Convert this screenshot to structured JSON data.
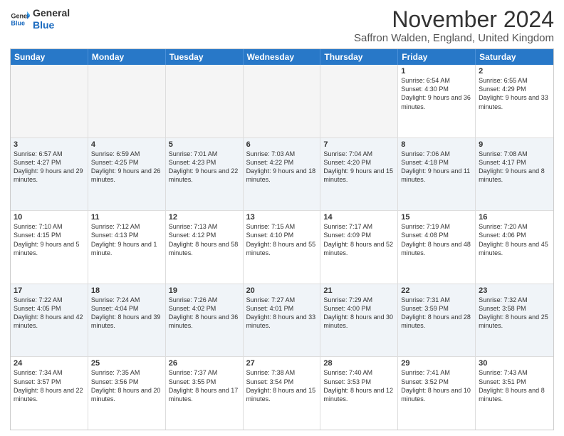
{
  "logo": {
    "general": "General",
    "blue": "Blue"
  },
  "title": "November 2024",
  "location": "Saffron Walden, England, United Kingdom",
  "header": {
    "days": [
      "Sunday",
      "Monday",
      "Tuesday",
      "Wednesday",
      "Thursday",
      "Friday",
      "Saturday"
    ]
  },
  "rows": [
    {
      "alt": false,
      "cells": [
        {
          "day": "",
          "text": "",
          "empty": true
        },
        {
          "day": "",
          "text": "",
          "empty": true
        },
        {
          "day": "",
          "text": "",
          "empty": true
        },
        {
          "day": "",
          "text": "",
          "empty": true
        },
        {
          "day": "",
          "text": "",
          "empty": true
        },
        {
          "day": "1",
          "text": "Sunrise: 6:54 AM\nSunset: 4:30 PM\nDaylight: 9 hours and 36 minutes.",
          "empty": false
        },
        {
          "day": "2",
          "text": "Sunrise: 6:55 AM\nSunset: 4:29 PM\nDaylight: 9 hours and 33 minutes.",
          "empty": false
        }
      ]
    },
    {
      "alt": true,
      "cells": [
        {
          "day": "3",
          "text": "Sunrise: 6:57 AM\nSunset: 4:27 PM\nDaylight: 9 hours and 29 minutes.",
          "empty": false
        },
        {
          "day": "4",
          "text": "Sunrise: 6:59 AM\nSunset: 4:25 PM\nDaylight: 9 hours and 26 minutes.",
          "empty": false
        },
        {
          "day": "5",
          "text": "Sunrise: 7:01 AM\nSunset: 4:23 PM\nDaylight: 9 hours and 22 minutes.",
          "empty": false
        },
        {
          "day": "6",
          "text": "Sunrise: 7:03 AM\nSunset: 4:22 PM\nDaylight: 9 hours and 18 minutes.",
          "empty": false
        },
        {
          "day": "7",
          "text": "Sunrise: 7:04 AM\nSunset: 4:20 PM\nDaylight: 9 hours and 15 minutes.",
          "empty": false
        },
        {
          "day": "8",
          "text": "Sunrise: 7:06 AM\nSunset: 4:18 PM\nDaylight: 9 hours and 11 minutes.",
          "empty": false
        },
        {
          "day": "9",
          "text": "Sunrise: 7:08 AM\nSunset: 4:17 PM\nDaylight: 9 hours and 8 minutes.",
          "empty": false
        }
      ]
    },
    {
      "alt": false,
      "cells": [
        {
          "day": "10",
          "text": "Sunrise: 7:10 AM\nSunset: 4:15 PM\nDaylight: 9 hours and 5 minutes.",
          "empty": false
        },
        {
          "day": "11",
          "text": "Sunrise: 7:12 AM\nSunset: 4:13 PM\nDaylight: 9 hours and 1 minute.",
          "empty": false
        },
        {
          "day": "12",
          "text": "Sunrise: 7:13 AM\nSunset: 4:12 PM\nDaylight: 8 hours and 58 minutes.",
          "empty": false
        },
        {
          "day": "13",
          "text": "Sunrise: 7:15 AM\nSunset: 4:10 PM\nDaylight: 8 hours and 55 minutes.",
          "empty": false
        },
        {
          "day": "14",
          "text": "Sunrise: 7:17 AM\nSunset: 4:09 PM\nDaylight: 8 hours and 52 minutes.",
          "empty": false
        },
        {
          "day": "15",
          "text": "Sunrise: 7:19 AM\nSunset: 4:08 PM\nDaylight: 8 hours and 48 minutes.",
          "empty": false
        },
        {
          "day": "16",
          "text": "Sunrise: 7:20 AM\nSunset: 4:06 PM\nDaylight: 8 hours and 45 minutes.",
          "empty": false
        }
      ]
    },
    {
      "alt": true,
      "cells": [
        {
          "day": "17",
          "text": "Sunrise: 7:22 AM\nSunset: 4:05 PM\nDaylight: 8 hours and 42 minutes.",
          "empty": false
        },
        {
          "day": "18",
          "text": "Sunrise: 7:24 AM\nSunset: 4:04 PM\nDaylight: 8 hours and 39 minutes.",
          "empty": false
        },
        {
          "day": "19",
          "text": "Sunrise: 7:26 AM\nSunset: 4:02 PM\nDaylight: 8 hours and 36 minutes.",
          "empty": false
        },
        {
          "day": "20",
          "text": "Sunrise: 7:27 AM\nSunset: 4:01 PM\nDaylight: 8 hours and 33 minutes.",
          "empty": false
        },
        {
          "day": "21",
          "text": "Sunrise: 7:29 AM\nSunset: 4:00 PM\nDaylight: 8 hours and 30 minutes.",
          "empty": false
        },
        {
          "day": "22",
          "text": "Sunrise: 7:31 AM\nSunset: 3:59 PM\nDaylight: 8 hours and 28 minutes.",
          "empty": false
        },
        {
          "day": "23",
          "text": "Sunrise: 7:32 AM\nSunset: 3:58 PM\nDaylight: 8 hours and 25 minutes.",
          "empty": false
        }
      ]
    },
    {
      "alt": false,
      "cells": [
        {
          "day": "24",
          "text": "Sunrise: 7:34 AM\nSunset: 3:57 PM\nDaylight: 8 hours and 22 minutes.",
          "empty": false
        },
        {
          "day": "25",
          "text": "Sunrise: 7:35 AM\nSunset: 3:56 PM\nDaylight: 8 hours and 20 minutes.",
          "empty": false
        },
        {
          "day": "26",
          "text": "Sunrise: 7:37 AM\nSunset: 3:55 PM\nDaylight: 8 hours and 17 minutes.",
          "empty": false
        },
        {
          "day": "27",
          "text": "Sunrise: 7:38 AM\nSunset: 3:54 PM\nDaylight: 8 hours and 15 minutes.",
          "empty": false
        },
        {
          "day": "28",
          "text": "Sunrise: 7:40 AM\nSunset: 3:53 PM\nDaylight: 8 hours and 12 minutes.",
          "empty": false
        },
        {
          "day": "29",
          "text": "Sunrise: 7:41 AM\nSunset: 3:52 PM\nDaylight: 8 hours and 10 minutes.",
          "empty": false
        },
        {
          "day": "30",
          "text": "Sunrise: 7:43 AM\nSunset: 3:51 PM\nDaylight: 8 hours and 8 minutes.",
          "empty": false
        }
      ]
    }
  ]
}
